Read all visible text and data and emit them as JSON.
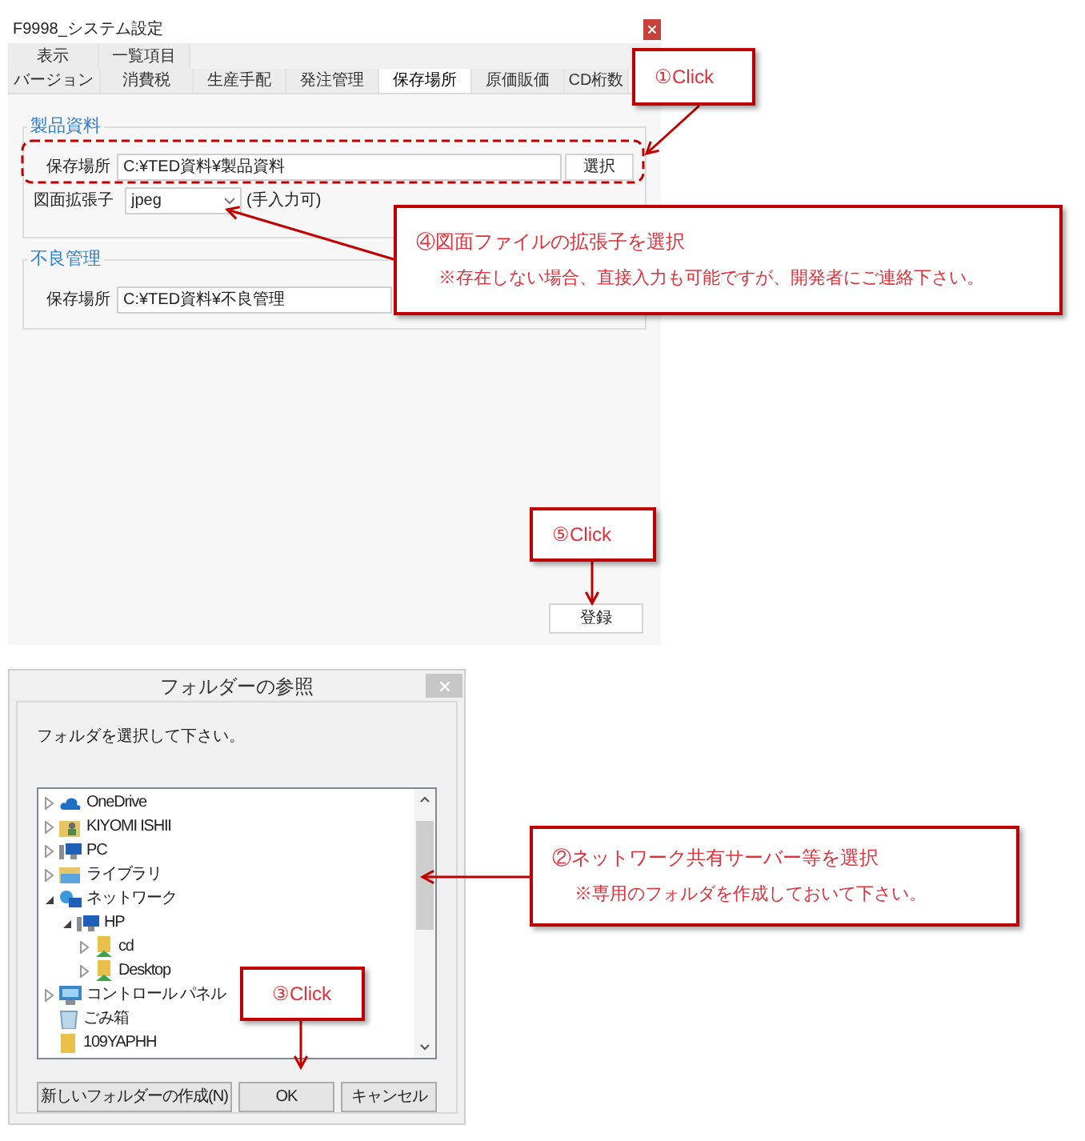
{
  "main_window": {
    "title": "F9998_システム設定",
    "tabs_row1": [
      {
        "label": "表示",
        "selected": false
      },
      {
        "label": "一覧項目",
        "selected": false
      }
    ],
    "tabs_row2": [
      {
        "label": "バージョン",
        "selected": false
      },
      {
        "label": "消費税",
        "selected": false
      },
      {
        "label": "生産手配",
        "selected": false
      },
      {
        "label": "発注管理",
        "selected": false
      },
      {
        "label": "保存場所",
        "selected": true
      },
      {
        "label": "原価販価",
        "selected": false
      },
      {
        "label": "CD桁数",
        "selected": false
      }
    ],
    "groups": [
      {
        "legend": "製品資料",
        "fields": [
          {
            "kind": "path",
            "label": "保存場所",
            "value": "C:¥TED資料¥製品資料",
            "button": "選択"
          },
          {
            "kind": "combo",
            "label": "図面拡張子",
            "value": "jpeg",
            "note": "(手入力可)"
          }
        ]
      },
      {
        "legend": "不良管理",
        "fields": [
          {
            "kind": "path",
            "label": "保存場所",
            "value": "C:¥TED資料¥不良管理"
          }
        ]
      }
    ],
    "register_button": "登録"
  },
  "dialog": {
    "title": "フォルダーの参照",
    "prompt": "フォルダを選択して下さい。",
    "tree": [
      {
        "label": "OneDrive",
        "kind": "cloud",
        "expanded": false
      },
      {
        "label": "KIYOMI ISHII",
        "kind": "user",
        "expanded": false
      },
      {
        "label": "PC",
        "kind": "pc",
        "expanded": false
      },
      {
        "label": "ライブラリ",
        "kind": "library",
        "expanded": false
      },
      {
        "label": "ネットワーク",
        "kind": "network",
        "expanded": true,
        "children": [
          {
            "label": "HP",
            "kind": "pc",
            "expanded": true,
            "children": [
              {
                "label": "cd",
                "kind": "share",
                "expanded": false
              },
              {
                "label": "Desktop",
                "kind": "share",
                "expanded": false
              }
            ]
          }
        ]
      },
      {
        "label": "コントロール パネル",
        "kind": "control",
        "expanded": false
      },
      {
        "label": "ごみ箱",
        "kind": "trash"
      },
      {
        "label": "109YAPHH",
        "kind": "folder"
      }
    ],
    "buttons": [
      "新しいフォルダーの作成(N)",
      "OK",
      "キャンセル"
    ]
  },
  "callouts": [
    {
      "lines": [
        "①Click"
      ]
    },
    {
      "lines": [
        "④図面ファイルの拡張子を選択",
        "※存在しない場合、直接入力も可能ですが、開発者にご連絡下さい。"
      ]
    },
    {
      "lines": [
        "⑤Click"
      ]
    },
    {
      "lines": [
        "②ネットワーク共有サーバー等を選択",
        "※専用のフォルダを作成しておいて下さい。"
      ]
    },
    {
      "lines": [
        "③Click"
      ]
    }
  ]
}
